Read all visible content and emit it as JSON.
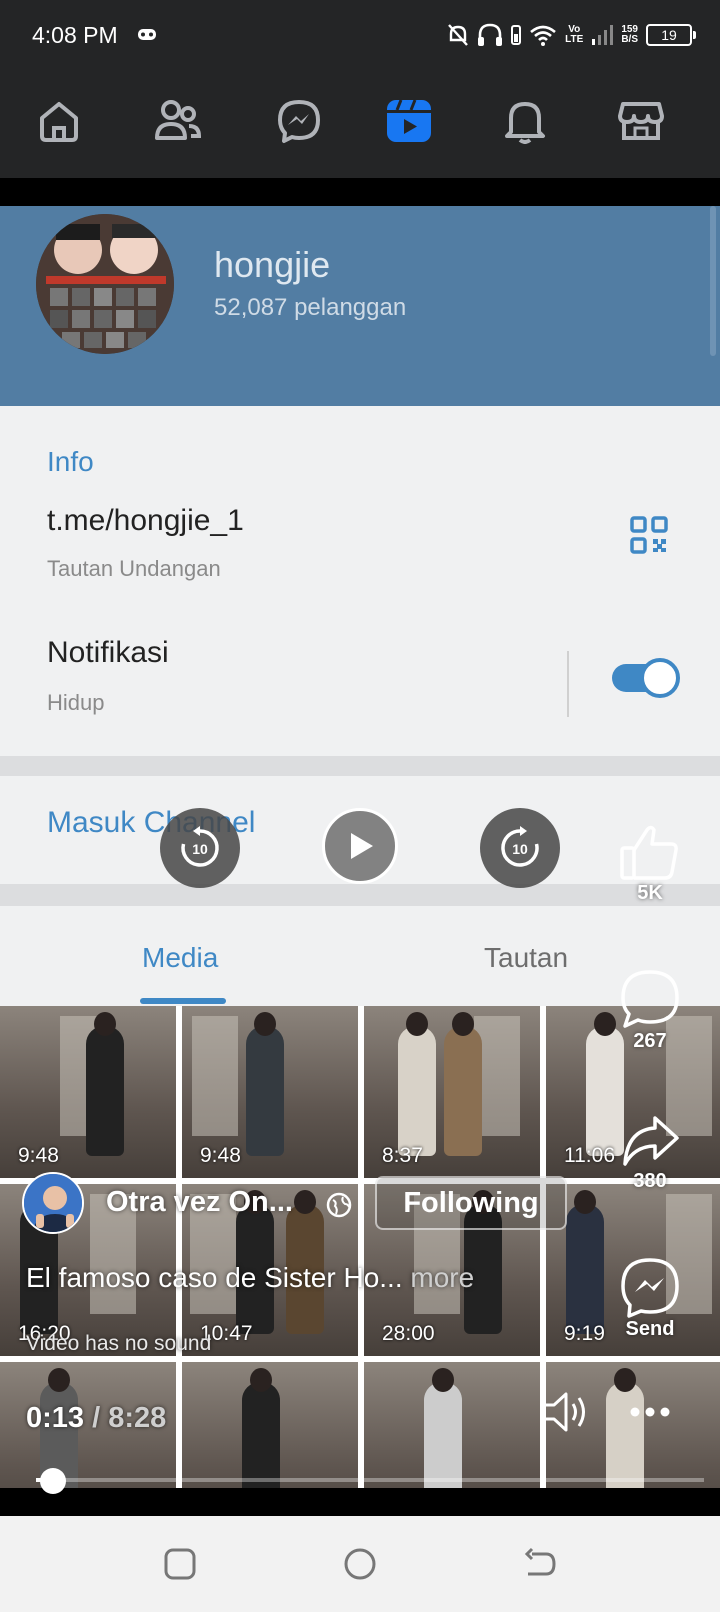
{
  "status_bar": {
    "time": "4:08 PM",
    "volte_top": "Vo",
    "volte_bottom": "LTE",
    "speed_value": "159",
    "speed_unit": "B/S",
    "battery": "19"
  },
  "fb_nav": {
    "items": [
      "home-icon",
      "friends-icon",
      "messenger-icon",
      "reels-icon",
      "notifications-icon",
      "marketplace-icon"
    ],
    "active": "reels-icon",
    "accent_color": "#1877f2"
  },
  "video_content": {
    "channel_name": "hongjie",
    "subscribers": "52,087 pelanggan",
    "info_title": "Info",
    "invite_link": "t.me/hongjie_1",
    "invite_link_label": "Tautan Undangan",
    "notifications_title": "Notifikasi",
    "notifications_state": "Hidup",
    "join_channel": "Masuk Channel",
    "tabs": [
      "Media",
      "Tautan"
    ],
    "durations": [
      "9:48",
      "9:48",
      "8:37",
      "11:06",
      "16:20",
      "10:47",
      "28:00",
      "9:19"
    ]
  },
  "player": {
    "skip_back_seconds": "10",
    "skip_forward_seconds": "10",
    "likes": "5K",
    "comments": "267",
    "shares": "380",
    "send_label": "Send",
    "page_name": "Otra vez On...",
    "follow_label": "Following",
    "caption": "El famoso caso de Sister Ho...",
    "caption_more": "more",
    "no_sound": "Video has no sound",
    "current_time": "0:13",
    "time_separator": "/",
    "total_time": "8:28",
    "progress_fraction": 0.026
  }
}
